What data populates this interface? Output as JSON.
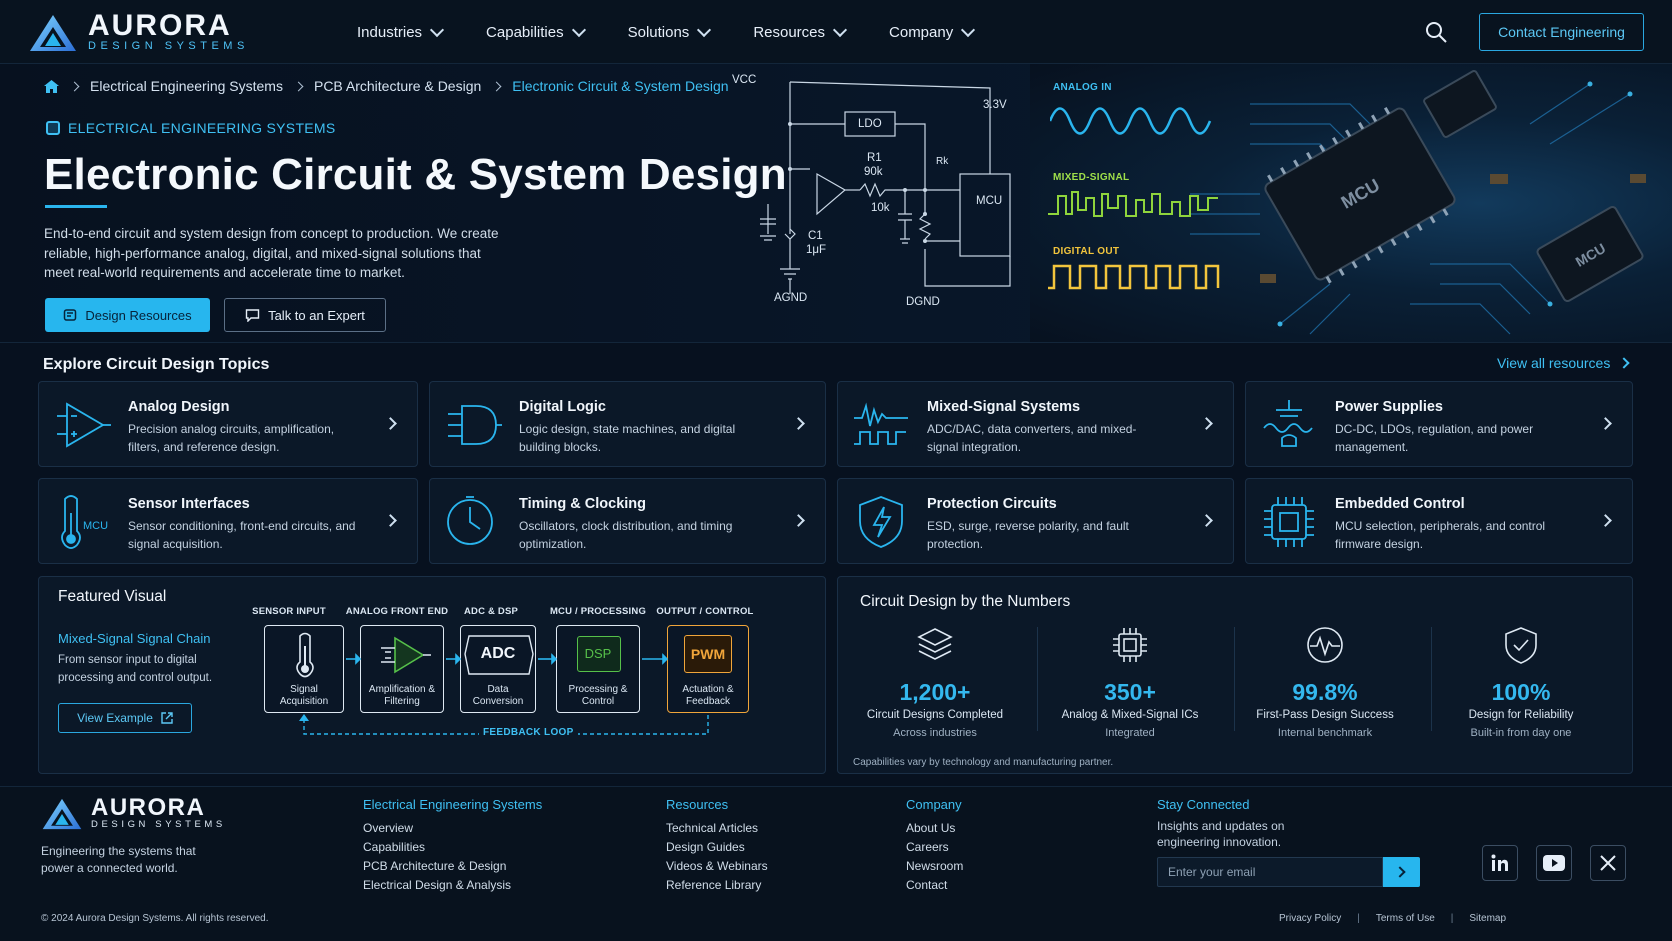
{
  "brand": {
    "name": "AURORA",
    "tagline": "DESIGN SYSTEMS",
    "accent": "#27b6ee",
    "background": "#07111f"
  },
  "nav": {
    "items": [
      {
        "label": "Industries"
      },
      {
        "label": "Capabilities"
      },
      {
        "label": "Solutions"
      },
      {
        "label": "Resources"
      },
      {
        "label": "Company"
      }
    ],
    "search_icon": "search-icon",
    "contact_label": "Contact Engineering"
  },
  "breadcrumb": [
    "Electrical Engineering Systems",
    "PCB Architecture & Design",
    "Electronic Circuit & System Design"
  ],
  "hero": {
    "eyebrow": "ELECTRICAL ENGINEERING SYSTEMS",
    "title": "Electronic Circuit & System Design",
    "description": "End-to-end circuit and system design from concept to production. We create reliable, high-performance analog, digital, and mixed-signal solutions that meet real-world requirements and accelerate time to market.",
    "primary_button": "Design Resources",
    "secondary_button": "Talk to an Expert",
    "schematic_labels": {
      "vcc": "VCC",
      "v33": "3.3V",
      "ldo": "LDO",
      "r1": "R1",
      "r1_val": "90k",
      "rk": "Rk",
      "r10k": "10k",
      "c1": "C1",
      "c1_val": "1μF",
      "mcu": "MCU",
      "agnd": "AGND",
      "dgnd": "DGND"
    },
    "wave_labels": {
      "analog": "ANALOG IN",
      "mixed": "MIXED-SIGNAL",
      "digital": "DIGITAL OUT"
    },
    "chip_labels": {
      "main": "MCU",
      "small": "MCU"
    }
  },
  "topics": {
    "title": "Explore Circuit Design Topics",
    "view_all": "View all resources",
    "cards": [
      {
        "title": "Analog Design",
        "desc": "Precision analog circuits, amplification, filters, and reference design.",
        "icon": "op-amp-icon"
      },
      {
        "title": "Digital Logic",
        "desc": "Logic design, state machines, and digital building blocks.",
        "icon": "logic-gate-icon"
      },
      {
        "title": "Mixed-Signal Systems",
        "desc": "ADC/DAC, data converters, and mixed-signal integration.",
        "icon": "waveform-icon"
      },
      {
        "title": "Power Supplies",
        "desc": "DC-DC, LDOs, regulation, and power management.",
        "icon": "power-supply-icon"
      },
      {
        "title": "Sensor Interfaces",
        "desc": "Sensor conditioning, front-end circuits, and signal acquisition.",
        "icon": "thermometer-icon",
        "icon_text": "MCU"
      },
      {
        "title": "Timing & Clocking",
        "desc": "Oscillators, clock distribution, and timing optimization.",
        "icon": "clock-icon"
      },
      {
        "title": "Protection Circuits",
        "desc": "ESD, surge, reverse polarity, and fault protection.",
        "icon": "shield-bolt-icon"
      },
      {
        "title": "Embedded Control",
        "desc": "MCU selection, peripherals, and control firmware design.",
        "icon": "chip-icon"
      }
    ]
  },
  "featured": {
    "title": "Featured Visual",
    "subtitle": "Mixed-Signal Signal Chain",
    "desc": "From sensor input to digital processing and control output.",
    "button": "View Example",
    "stages": [
      {
        "head": "SENSOR INPUT",
        "caption": "Signal Acquisition"
      },
      {
        "head": "ANALOG FRONT END",
        "caption": "Amplification & Filtering"
      },
      {
        "head": "ADC & DSP",
        "caption": "Data Conversion",
        "chip": "ADC"
      },
      {
        "head": "MCU / PROCESSING",
        "caption": "Processing & Control",
        "chip": "DSP"
      },
      {
        "head": "OUTPUT / CONTROL",
        "caption": "Actuation & Feedback",
        "chip": "PWM"
      }
    ],
    "feedback": "FEEDBACK LOOP"
  },
  "numbers": {
    "title": "Circuit Design by the Numbers",
    "stats": [
      {
        "value": "1,200+",
        "label": "Circuit Designs Completed",
        "sub": "Across industries",
        "icon": "layers-icon"
      },
      {
        "value": "350+",
        "label": "Analog & Mixed-Signal ICs",
        "sub": "Integrated",
        "icon": "chip-icon"
      },
      {
        "value": "99.8%",
        "label": "First-Pass Design Success",
        "sub": "Internal benchmark",
        "icon": "pulse-icon"
      },
      {
        "value": "100%",
        "label": "Design for Reliability",
        "sub": "Built-in from day one",
        "icon": "shield-check-icon"
      }
    ],
    "note": "Capabilities vary by technology and manufacturing partner."
  },
  "footer": {
    "tagline": "Engineering the systems that power a connected world.",
    "columns": [
      {
        "title": "Electrical Engineering Systems",
        "links": [
          "Overview",
          "Capabilities",
          "PCB Architecture & Design",
          "Electrical Design & Analysis"
        ]
      },
      {
        "title": "Resources",
        "links": [
          "Technical Articles",
          "Design Guides",
          "Videos & Webinars",
          "Reference Library"
        ]
      },
      {
        "title": "Company",
        "links": [
          "About Us",
          "Careers",
          "Newsroom",
          "Contact"
        ]
      }
    ],
    "stay": {
      "title": "Stay Connected",
      "desc": "Insights and updates on engineering innovation.",
      "placeholder": "Enter your email"
    },
    "social": [
      "linkedin-icon",
      "youtube-icon",
      "x-icon"
    ],
    "copyright": "© 2024 Aurora Design Systems. All rights reserved.",
    "legal": [
      "Privacy Policy",
      "Terms of Use",
      "Sitemap"
    ]
  }
}
